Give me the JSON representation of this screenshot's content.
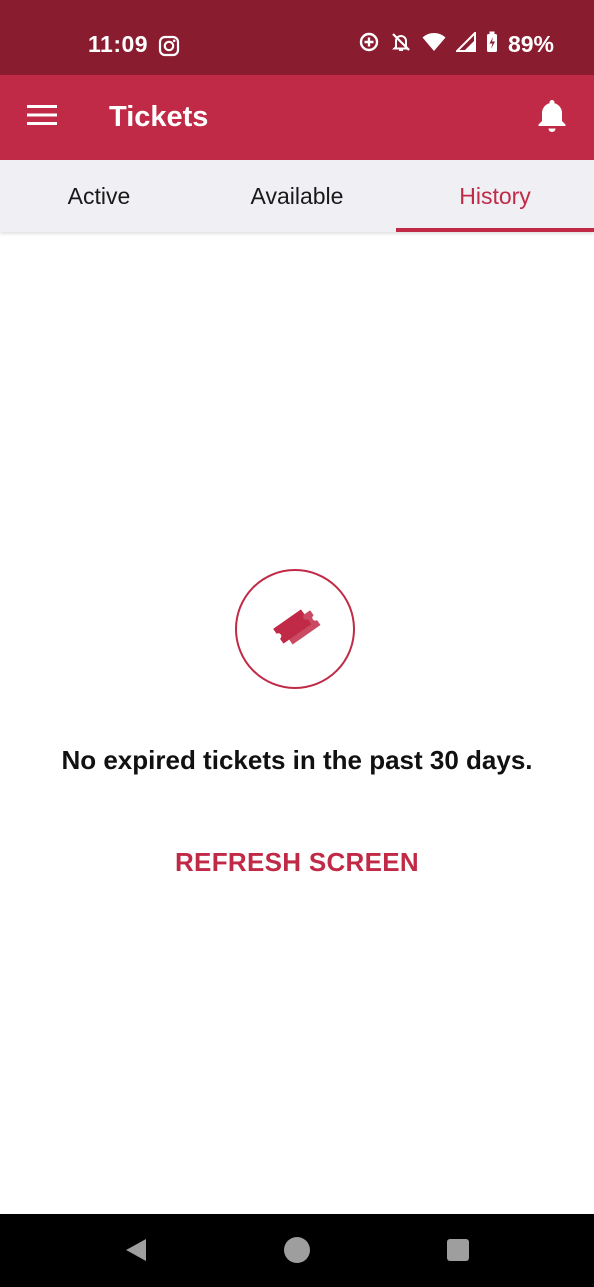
{
  "status_bar": {
    "time": "11:09",
    "battery": "89%",
    "icons": [
      "instagram-icon",
      "data-saver-icon",
      "notifications-off-icon",
      "wifi-icon",
      "cell-signal-icon",
      "battery-charging-icon"
    ]
  },
  "app_bar": {
    "title": "Tickets",
    "menu_icon": "menu-icon",
    "notification_icon": "bell-icon"
  },
  "tabs": [
    {
      "label": "Active",
      "selected": false
    },
    {
      "label": "Available",
      "selected": false
    },
    {
      "label": "History",
      "selected": true
    }
  ],
  "empty_state": {
    "icon": "ticket-icon",
    "message": "No expired tickets in the past 30 days.",
    "action_label": "REFRESH SCREEN"
  },
  "nav_bar": {
    "icons": [
      "back-icon",
      "home-icon",
      "recents-icon"
    ]
  },
  "colors": {
    "status_bar": "#8a1c30",
    "app_bar": "#c02a46",
    "accent": "#c02a46",
    "tab_bar": "#efeff4"
  }
}
